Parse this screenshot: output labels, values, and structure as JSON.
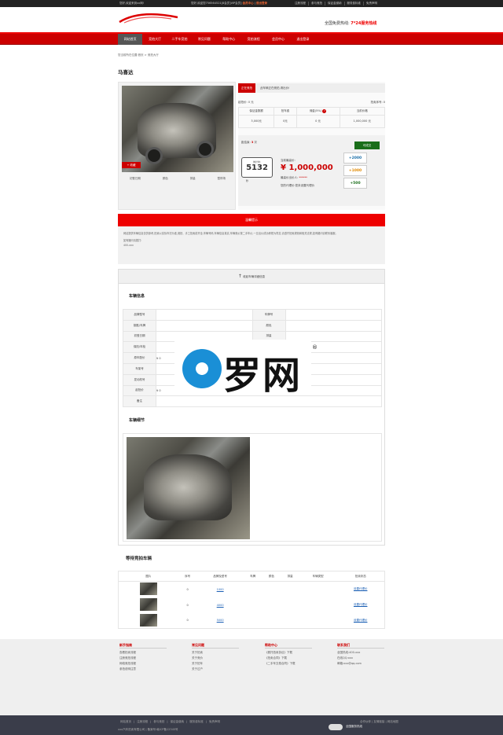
{
  "topbar": {
    "welcome": "您好,欢迎来到xx网!",
    "greeting": "您好,欢迎您756564521[8会员]VIP会员]",
    "member_center": "会员中心",
    "logout": "退出登录",
    "links": [
      "注册流程",
      "参与竞拍",
      "保证金缴纳",
      "服务费标准",
      "免责声明"
    ]
  },
  "header": {
    "hotline_label": "全国免费热线:",
    "hotline_value": "7*24服务热线"
  },
  "nav": {
    "items": [
      "网站首页",
      "竞拍大厅",
      "二手车竞拍",
      "常见问题",
      "帮助中心",
      "竞拍流程",
      "会员中心",
      "退出登录"
    ],
    "active": 0
  },
  "breadcrumb": "您当前所在位置:首页 > 竞拍大厅",
  "car_title": "马喜达",
  "left": {
    "fav": "+ 收藏",
    "labels": [
      "初登日期",
      "颜色",
      "排量",
      "暂停场"
    ]
  },
  "status": {
    "tag": "正在竞拍",
    "text": "此车辆正在竞拍,请出价!"
  },
  "info": {
    "start_price_label": "起拍价:",
    "start_price": "0 元",
    "lot_label": "拍卖序号:",
    "lot": "0"
  },
  "info_table": {
    "headers": [
      "保证金数额",
      "拍车费",
      "佣金(5%)",
      "当前价格"
    ],
    "values": [
      "3,000元",
      "0元",
      "0 元",
      "1,000,000 元"
    ]
  },
  "bid": {
    "countdown_label": "距结束:",
    "countdown_value": "3",
    "countdown_unit": "次",
    "done_tag": "可成交",
    "timer_label": "倒计时:",
    "timer_value": "5132",
    "timer_unit": "秒",
    "current_price_label": "当前最高价:",
    "current_price": "¥ 1,000,000",
    "bidder_label": "最高价出价人:",
    "bidder": "******",
    "proxy": "您的代理价:您未设置代理价",
    "increments": [
      "+2000",
      "+1000",
      "+500"
    ]
  },
  "notice": {
    "title": "温馨提示",
    "body": "网站提供车辆信息仅供参考,拍卖以实际车况为准,竞拍、手工拍卖前开全,车辆号码,车辆信息真实,车辆竞价按二手车价,一旦出价成功即视为同意,请遵守拍卖规则和相关法规,如有疑问请联系客服。",
    "contact_label": "如有疑问请拨打:",
    "contact": "400-xxx"
  },
  "collapse": "收起车辆详细信息",
  "vehicle": {
    "title": "车辆信息",
    "rows": [
      [
        "品牌型号",
        "",
        "车牌号",
        ""
      ],
      [
        "钥匙/车牌",
        "",
        "颜色",
        ""
      ],
      [
        "初登日期",
        "",
        "排量",
        ""
      ],
      [
        "保险/年检",
        "",
        "",
        ""
      ],
      [
        "原车配价",
        "¥ 0",
        "",
        ""
      ],
      [
        "车架号",
        "",
        "",
        ""
      ],
      [
        "发动机号",
        "",
        "",
        ""
      ],
      [
        "起拍价",
        "¥ 0",
        "",
        ""
      ],
      [
        "备注",
        "",
        "",
        ""
      ]
    ]
  },
  "gallery_title": "车辆细节",
  "watermark": {
    "text": "罗网",
    "reg": "®"
  },
  "waiting": {
    "title": "等待竞拍车辆",
    "headers": [
      "图片",
      "序号",
      "品牌及型号",
      "车牌",
      "颜色",
      "排量",
      "车辆类型",
      "拍卖状态"
    ],
    "rows": [
      {
        "seq": "0",
        "model": "1000",
        "status": "设置代理价"
      },
      {
        "seq": "0",
        "model": "4000",
        "status": "设置代理价"
      },
      {
        "seq": "0",
        "model": "5000",
        "status": "设置代理价"
      }
    ]
  },
  "footer": {
    "cols": [
      {
        "h": "新手指南",
        "items": [
          "查看拍卖流程",
          "注册竞拍流程",
          "网络竞拍流程",
          "参拍说明注意"
        ]
      },
      {
        "h": "常见问题",
        "items": [
          "关于拍卖",
          "关于竞价",
          "关于拍车",
          "关于过户"
        ]
      },
      {
        "h": "帮助中心",
        "items": [
          "《委托拍卖协议》下载",
          "《拍卖合同》下载",
          "《二手车交易合同》下载"
        ]
      },
      {
        "h": "联系我们",
        "items": [
          "全国热线:400-xxx",
          "在线QQ:xxx",
          "邮箱:xxx@qq.com"
        ]
      }
    ]
  },
  "bottom": {
    "links": [
      "网站首页",
      "注册流程",
      "参与竞拍",
      "保证金缴纳",
      "服务费标准",
      "免责声明"
    ],
    "copyright": "xxx汽车拍卖有限公司 | 备案号:赣ICP备12345号",
    "right": "合作伙伴 | 友情链接 | 网站地图",
    "badge_text": "全国服务热线"
  }
}
